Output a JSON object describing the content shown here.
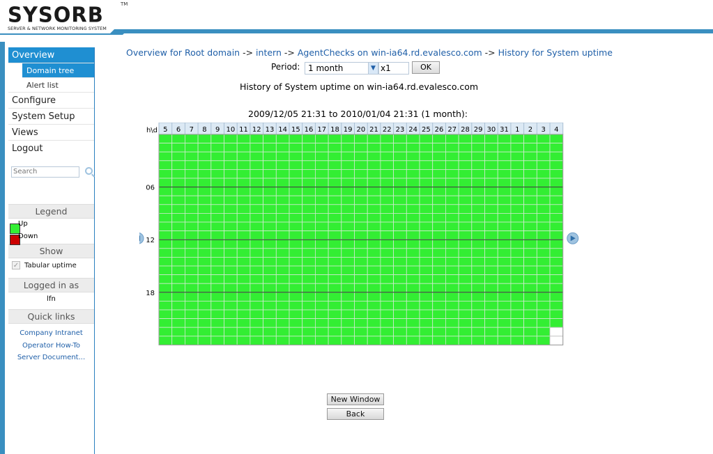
{
  "header": {
    "logo_text": "SYSORB",
    "logo_tm": "TM",
    "logo_subtitle": "SERVER & NETWORK MONITORING SYSTEM"
  },
  "sidebar": {
    "nav": [
      {
        "label": "Overview",
        "active": true
      },
      {
        "label": "Configure",
        "active": false
      },
      {
        "label": "System Setup",
        "active": false
      },
      {
        "label": "Views",
        "active": false
      },
      {
        "label": "Logout",
        "active": false
      }
    ],
    "overview_sub": [
      {
        "label": "Domain tree",
        "active": true
      },
      {
        "label": "Alert list",
        "active": false
      }
    ],
    "search_placeholder": "Search",
    "legend": {
      "title": "Legend",
      "up_label": "Up",
      "down_label": "Down",
      "up_color": "#33ee33",
      "down_color": "#cc0000"
    },
    "show": {
      "title": "Show",
      "tabular_label": "Tabular uptime",
      "tabular_checked": true
    },
    "logged_in": {
      "title": "Logged in as",
      "user": "lfn"
    },
    "quick_links": {
      "title": "Quick links",
      "items": [
        "Company Intranet",
        "Operator How-To",
        "Server Document..."
      ]
    }
  },
  "breadcrumb": {
    "items": [
      "Overview for Root domain",
      "intern",
      "AgentChecks on win-ia64.rd.evalesco.com",
      "History for System uptime"
    ],
    "separator": "->"
  },
  "period": {
    "label": "Period:",
    "selected": "1 month",
    "multiplier": "x1",
    "ok_label": "OK"
  },
  "history_title": "History of System uptime on win-ia64.rd.evalesco.com",
  "range_title": "2009/12/05 21:31 to 2010/01/04 21:31 (1 month):",
  "buttons": {
    "new_window": "New Window",
    "back": "Back"
  },
  "chart_data": {
    "type": "heatmap",
    "corner_label": "h\\d",
    "days": [
      "5",
      "6",
      "7",
      "8",
      "9",
      "10",
      "11",
      "12",
      "13",
      "14",
      "15",
      "16",
      "17",
      "18",
      "19",
      "20",
      "21",
      "22",
      "23",
      "24",
      "25",
      "26",
      "27",
      "28",
      "29",
      "30",
      "31",
      "1",
      "2",
      "3",
      "4"
    ],
    "hour_labels": [
      "06",
      "12",
      "18"
    ],
    "hours": 24,
    "state": "up for all hours up to 2010/01/04 21:31; remaining hours of last day empty",
    "last_day_filled_hours": 22,
    "up_color": "#33ee33",
    "grid_color": "#cfeacf"
  }
}
